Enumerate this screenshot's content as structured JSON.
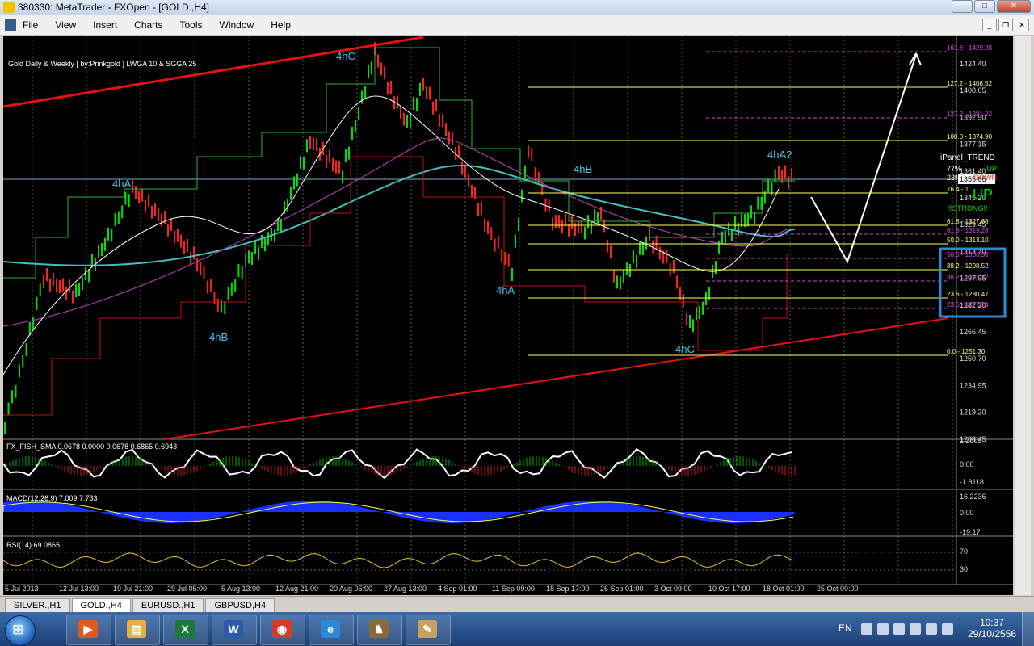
{
  "window": {
    "title": "380330: MetaTrader - FXOpen - [GOLD.,H4]",
    "min": "–",
    "max": "□",
    "close": "✕"
  },
  "menu": [
    "File",
    "View",
    "Insert",
    "Charts",
    "Tools",
    "Window",
    "Help"
  ],
  "mdi": {
    "min": "_",
    "restore": "❐",
    "close": "✕"
  },
  "chart": {
    "caption": "Gold Daily & Weekly [ by:Prinkgold ] LWGA 10  &  SGGA 25",
    "current_price": "1355.65",
    "price_axis": [
      "1424.40",
      "1408.65",
      "1392.90",
      "1377.15",
      "1361.40",
      "1345.20",
      "1329.45",
      "1313.70",
      "1297.95",
      "1282.20",
      "1266.45",
      "1250.70",
      "1234.95",
      "1219.20",
      "1203.45"
    ],
    "time_axis": [
      "5 Jul 2013",
      "12 Jul 13:00",
      "19 Jul 21:00",
      "29 Jul 05:00",
      "5 Aug 13:00",
      "12 Aug 21:00",
      "20 Aug 05:00",
      "27 Aug 13:00",
      "4 Sep 01:00",
      "11 Sep 09:00",
      "18 Sep 17:00",
      "26 Sep 01:00",
      "3 Oct 09:00",
      "10 Oct 17:00",
      "18 Oct 01:00",
      "25 Oct 09:00"
    ],
    "wave_labels": [
      "4hA",
      "4hB",
      "4hC",
      "4hA",
      "4hB",
      "4hC",
      "4hA?"
    ],
    "fib_yellow": [
      "127.2 - 1408.52",
      "100.0 - 1374.90",
      "76.4 - 1",
      "61.8 - 1327.68",
      "50.0 - 1313.10",
      "38.2 - 1298.52",
      "23.6 - 1280.47",
      "0.0 - 1251.30"
    ],
    "fib_magenta": [
      "161.8 - 1429.28",
      "127.2 - 1391.22",
      "61.8 - 1319.28",
      "50.0 - 1306.30",
      "38.2 - 1293.32",
      "23.6 - 1277.24"
    ],
    "ipanel": {
      "title": "iPanel_TREND",
      "up_pct": "77%",
      "up_label": "UP",
      "down_pct": "23%",
      "down_label": "DOWN",
      "direction": "UP",
      "strength": "!!STRONG!!"
    },
    "fisher": {
      "label": "FX_FISH_SMA 0.0678 0.0000 0.0678 0.6865 0.6943",
      "axis": [
        "1.2803",
        "0.00",
        "-1.8118"
      ]
    },
    "macd": {
      "label": "MACD(12,26,9) 7.009 7.733",
      "axis": [
        "16.2236",
        "0.00",
        "-19.17"
      ]
    },
    "rsi": {
      "label": "RSI(14) 69.0865",
      "axis": [
        "70",
        "30"
      ]
    },
    "colors": {
      "bull": "#00e000",
      "bear": "#ff2020",
      "trendline": "#e81010",
      "ma_fast": "#ffffff",
      "ma_slow": "#40c0c0",
      "ma_mid": "#c040c0",
      "fib_yellow": "#ffff60",
      "fib_magenta": "#e040e0",
      "box": "#2a8ad8"
    }
  },
  "tabs": [
    "SILVER.,H1",
    "GOLD.,H4",
    "EURUSD.,H1",
    "GBPUSD,H4"
  ],
  "taskbar": {
    "apps": [
      {
        "name": "media",
        "glyph": "▶",
        "color": "#e05a20"
      },
      {
        "name": "folder",
        "glyph": "▤",
        "color": "#e8b040"
      },
      {
        "name": "excel",
        "glyph": "X",
        "color": "#1e7a3a"
      },
      {
        "name": "word",
        "glyph": "W",
        "color": "#2a5aa8"
      },
      {
        "name": "chrome",
        "glyph": "◉",
        "color": "#d83a2a"
      },
      {
        "name": "ie",
        "glyph": "e",
        "color": "#2a8ad8"
      },
      {
        "name": "metatrader",
        "glyph": "♞",
        "color": "#8a6a3a"
      },
      {
        "name": "paint",
        "glyph": "✎",
        "color": "#c8a060"
      }
    ],
    "lang": "EN",
    "time": "10:37",
    "date": "29/10/2556"
  }
}
